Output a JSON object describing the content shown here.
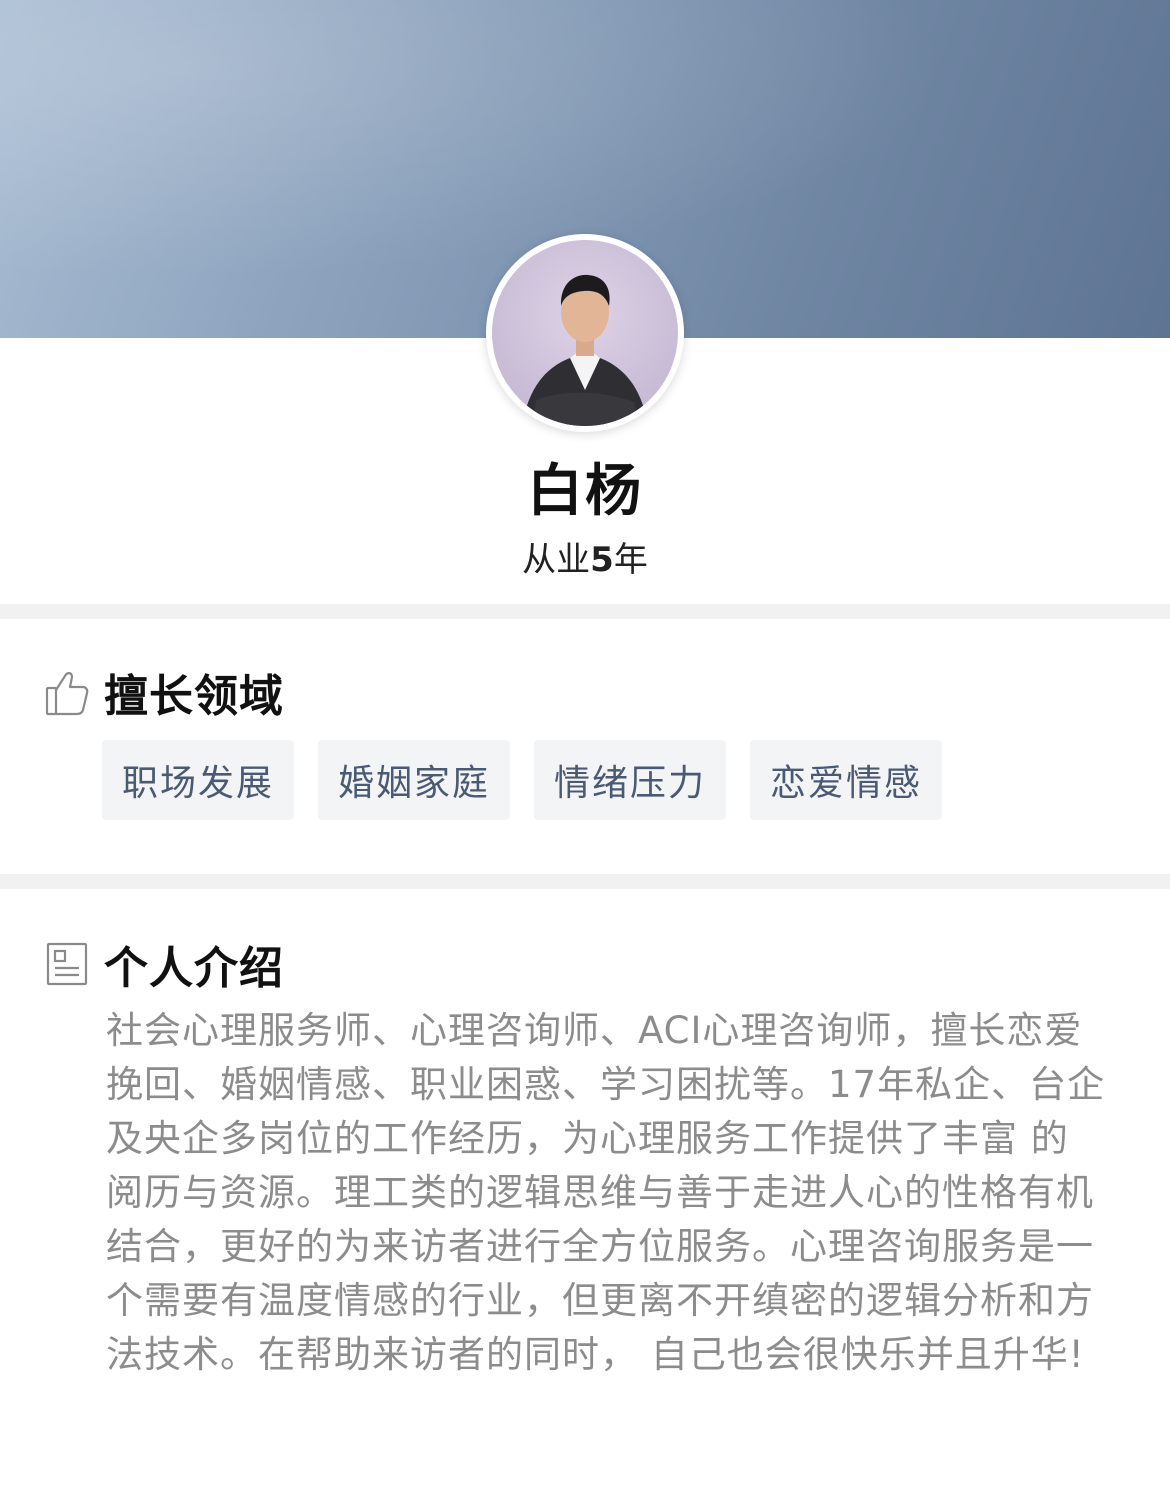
{
  "profile": {
    "name": "白杨",
    "years_prefix": "从业",
    "years_value": "5",
    "years_suffix": "年"
  },
  "expertise": {
    "title": "擅长领域",
    "icon": "thumbs-up-icon",
    "tags": [
      "职场发展",
      "婚姻家庭",
      "情绪压力",
      "恋爱情感"
    ]
  },
  "intro": {
    "title": "个人介绍",
    "icon": "document-icon",
    "text": "社会心理服务师、心理咨询师、ACI心理咨询师，擅长恋爱挽回、婚姻情感、职业困惑、学习困扰等。17年私企、台企及央企多岗位的工作经历，为心理服务工作提供了丰富 的阅历与资源。理工类的逻辑思维与善于走进人心的性格有机结合，更好的为来访者进行全方位服务。心理咨询服务是一个需要有温度情感的行业，但更离不开缜密的逻辑分析和方法技术。在帮助来访者的同时， 自己也会很快乐并且升华!"
  },
  "colors": {
    "banner_start": "#a9bdd3",
    "banner_end": "#5d7492",
    "tag_bg": "#f3f4f6",
    "tag_text": "#4a5a73",
    "intro_text": "#8c8c8c",
    "divider": "#f1f1f1"
  }
}
